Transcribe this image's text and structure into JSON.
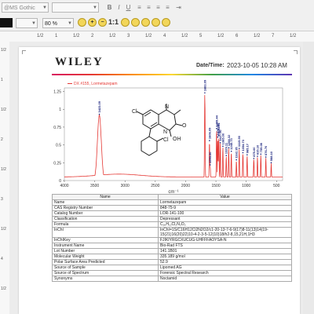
{
  "toolbar": {
    "font_name": "@MS Gothic",
    "font_size": "",
    "bold_label": "B",
    "italic_label": "I",
    "underline_label": "U",
    "zoom_value": "80 %",
    "zoom_reset_label": "1:1",
    "zoom_in_label": "+",
    "zoom_out_label": "−"
  },
  "ruler": {
    "top_labels": [
      "1/2",
      "1",
      "1/2",
      "2",
      "1/2",
      "3",
      "1/2",
      "4",
      "1/2",
      "5",
      "1/2",
      "6",
      "1/2",
      "7",
      "1/2"
    ],
    "left_labels": [
      "1/2",
      "1",
      "1/2",
      "2",
      "1/2",
      "3",
      "1/2",
      "4",
      "1/2"
    ]
  },
  "report": {
    "brand": "WILEY",
    "date_label": "Date/Time:",
    "date_value": "2023-10-05 10:28 AM",
    "legend": "DX #155, Lormetazepam"
  },
  "chart_data": {
    "type": "line",
    "xlabel": "cm⁻¹",
    "xlim": [
      4000,
      400
    ],
    "ylim": [
      0,
      1.3
    ],
    "xticks": [
      "4000",
      "3500",
      "3000",
      "2500",
      "2000",
      "1500",
      "1000",
      "500"
    ],
    "yticks": [
      "0",
      "0.25",
      "0.5",
      "0.75",
      "1",
      "1.25"
    ],
    "series": [
      {
        "name": "DX #155, Lormetazepam",
        "color": "#e53935"
      }
    ],
    "peaks": [
      {
        "x": 3423.09,
        "y": 0.92,
        "label": "3423.09"
      },
      {
        "x": 1683.09,
        "y": 1.22,
        "label": "1683.09"
      },
      {
        "x": 1595.5,
        "y": 0.21,
        "label": "1595.50"
      },
      {
        "x": 1329.11,
        "y": 0.34,
        "label": "1329.11"
      },
      {
        "x": 1162.35,
        "y": 0.28,
        "label": "1162.35"
      },
      {
        "x": 1606.09,
        "y": 0.55,
        "label": "1606.09"
      },
      {
        "x": 1489.44,
        "y": 0.72,
        "label": "1489.44"
      },
      {
        "x": 1470.08,
        "y": 0.6,
        "label": "1470.08"
      },
      {
        "x": 1453.61,
        "y": 0.62,
        "label": "1453.61"
      },
      {
        "x": 1427.9,
        "y": 0.52,
        "label": "1427.90"
      },
      {
        "x": 1385.0,
        "y": 0.47,
        "label": "1385.00"
      },
      {
        "x": 1288.32,
        "y": 0.45,
        "label": "1288.32"
      },
      {
        "x": 1245.73,
        "y": 0.4,
        "label": "1245.73"
      },
      {
        "x": 1115.5,
        "y": 0.44,
        "label": "1115.50"
      },
      {
        "x": 1054.73,
        "y": 0.38,
        "label": "1054.73"
      },
      {
        "x": 985.17,
        "y": 0.35,
        "label": "985.17"
      },
      {
        "x": 875.0,
        "y": 0.3,
        "label": "875.00"
      },
      {
        "x": 815.1,
        "y": 0.33,
        "label": "815.10"
      },
      {
        "x": 759.08,
        "y": 0.36,
        "label": "759.08"
      },
      {
        "x": 676.7,
        "y": 0.32,
        "label": "676.70"
      },
      {
        "x": 588.1,
        "y": 0.24,
        "label": "588.10"
      }
    ]
  },
  "molecule": {
    "atoms": [
      "Cl",
      "N",
      "O",
      "N",
      "OH",
      "Cl"
    ]
  },
  "table": {
    "headers": [
      "Name",
      "Value"
    ],
    "rows": [
      [
        "Name",
        "Lormetazepam"
      ],
      [
        "CAS Registry Number",
        "848-75-9"
      ],
      [
        "Catalog Number",
        "LOR-141-100"
      ],
      [
        "Classification",
        "Depressant"
      ],
      [
        "Formula",
        "C₁₆H₁₂Cl₂N₂O₂"
      ],
      [
        "InChI",
        "InChI=1S/C16H12Cl2N2O2/c1-20-13-7-6-9(17)8-11(13)14(19-15(21)16(20)22)10-4-2-3-5-12(10)18/h2-8,15,21H,1H3"
      ],
      [
        "InChIKey",
        "FJIKIYRGCXUCUG-UHFFFAOYSA-N"
      ],
      [
        "Instrument Name",
        "Bio-Rad FTS"
      ],
      [
        "Lot Number",
        "141.1B01"
      ],
      [
        "Molecular Weight",
        "335.189 g/mol"
      ],
      [
        "Polar Surface Area Predicted",
        "52.9"
      ],
      [
        "Source of Sample",
        "Lipomed AG"
      ],
      [
        "Source of Spectrum",
        "Forensic Spectral Research"
      ],
      [
        "Synonyms",
        "Noctamid"
      ]
    ]
  },
  "colors": {
    "spectrum": "#e53935",
    "peak_label": "#1a237e",
    "zoom_icon": "#f2d65a"
  }
}
